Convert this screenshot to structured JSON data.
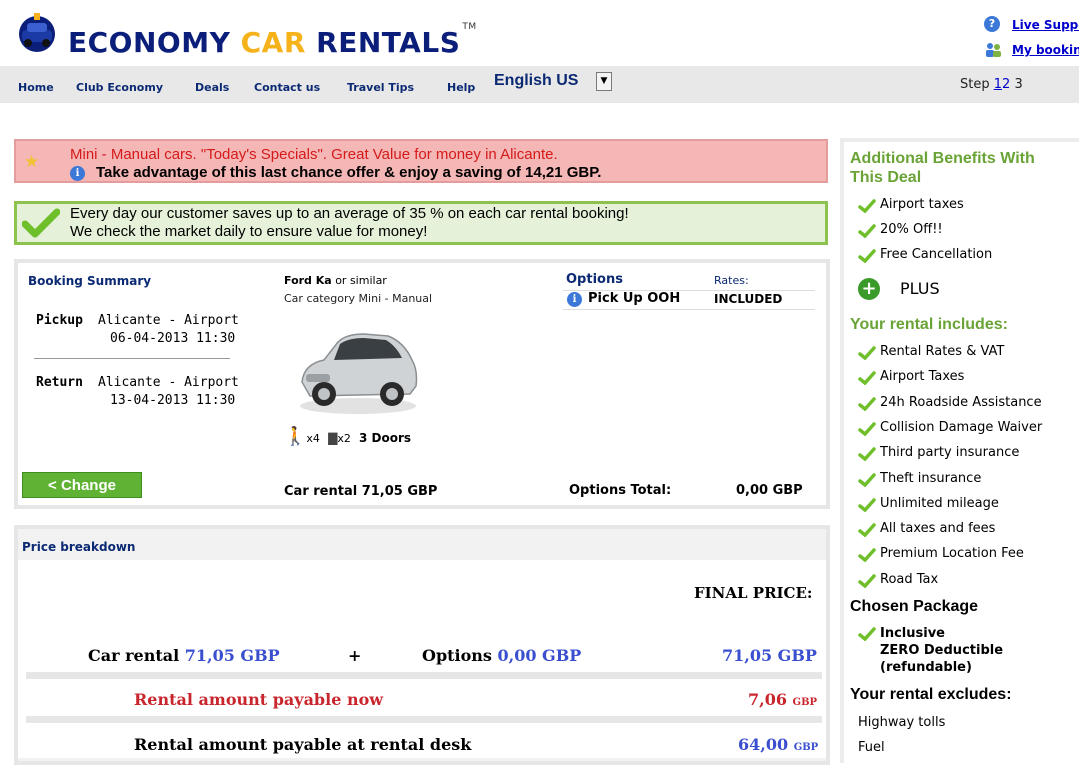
{
  "header": {
    "logo_main": "ECONOMY ",
    "logo_car": "CAR",
    "logo_rentals": " RENTALS",
    "logo_tm": "TM",
    "live_support": "Live Suppo",
    "my_booking": "My bookin"
  },
  "nav": {
    "items": [
      "Home",
      "Club Economy",
      "Deals",
      "Contact us",
      "Travel Tips",
      "Help"
    ],
    "language": "English US",
    "step_label": "Step",
    "steps": [
      "1",
      "2",
      "3"
    ]
  },
  "special": {
    "line1": "Mini - Manual cars. \"Today's Specials\". Great Value for money in Alicante.",
    "line2": "Take advantage of this last chance offer & enjoy a saving of 14,21 GBP."
  },
  "savings": {
    "line1": "Every day our customer saves up to an average of 35 % on each car rental booking!",
    "line2": "We check the market daily to ensure value for money!"
  },
  "summary": {
    "title": "Booking Summary",
    "pickup_label": "Pickup",
    "pickup_location": "Alicante - Airport",
    "pickup_datetime": "06-04-2013 11:30",
    "return_label": "Return",
    "return_location": "Alicante - Airport",
    "return_datetime": "13-04-2013 11:30",
    "change_button": "< Change",
    "car_model": "Ford Ka",
    "car_model_suffix": " or similar",
    "car_category": "Car category Mini - Manual",
    "passengers": "x4",
    "bags": "x2",
    "doors": "3 Doors",
    "car_rental": "Car rental 71,05 GBP"
  },
  "options": {
    "title": "Options",
    "rates_label": "Rates:",
    "item_name": "Pick Up OOH",
    "item_value": "INCLUDED",
    "total_label": "Options Total:",
    "total_value": "0,00 GBP"
  },
  "price": {
    "title": "Price breakdown",
    "final_price_label": "FINAL PRICE:",
    "car_rental_label": "Car rental ",
    "car_rental_value": "71,05 GBP",
    "plus": "+",
    "options_label": "Options ",
    "options_value": "0,00 GBP",
    "total": "71,05 GBP",
    "payable_now_label": "Rental amount payable now",
    "payable_now_value": "7,06",
    "payable_desk_label": "Rental amount payable at rental desk",
    "payable_desk_value": "64,00",
    "currency_small": "GBP"
  },
  "sidebar": {
    "benefits_title_1": "Additional Benefits With",
    "benefits_title_2": "This Deal",
    "benefits": [
      "Airport taxes",
      "20% Off!!",
      "Free Cancellation"
    ],
    "plus_label": "PLUS",
    "includes_title": "Your rental includes:",
    "includes": [
      "Rental Rates & VAT",
      "Airport Taxes",
      "24h Roadside Assistance",
      "Collision Damage Waiver",
      "Third party insurance",
      "Theft insurance",
      "Unlimited mileage",
      "All taxes and fees",
      "Premium Location Fee",
      "Road Tax"
    ],
    "package_title": "Chosen Package",
    "package_line1": "Inclusive",
    "package_line2": "ZERO Deductible",
    "package_line3": "(refundable)",
    "excludes_title": "Your rental excludes:",
    "excludes": [
      "Highway tolls",
      "Fuel"
    ]
  },
  "colors": {
    "brand_navy": "#0a1e7a",
    "brand_yellow": "#f5b21b",
    "accent_green": "#6aa336",
    "price_blue": "#3a4fcf",
    "price_red": "#c9252d"
  }
}
